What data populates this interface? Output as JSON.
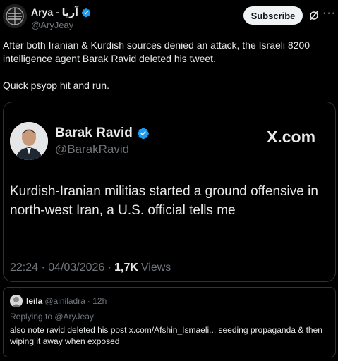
{
  "author": {
    "display_name": "Arya - آریا",
    "handle": "@AryJeay"
  },
  "actions": {
    "subscribe_label": "Subscribe",
    "more_label": "···"
  },
  "tweet": {
    "line1": "After both Iranian & Kurdish sources denied an attack, the Israeli 8200 intelligence agent Barak Ravid deleted his tweet.",
    "line2": "Quick psyop hit and run."
  },
  "embedded": {
    "name": "Barak Ravid",
    "handle": "@BarakRavid",
    "brand": "X.com",
    "text": "Kurdish-Iranian militias started a ground offensive in north-west Iran, a U.S. official tells me",
    "time": "22:24 · 04/03/2026 ·",
    "views_count": "1,7K",
    "views_label": "Views"
  },
  "reply": {
    "name": "leila",
    "handle": "@ainiladra",
    "time": "· 12h",
    "replying_to": "Replying to @AryJeay",
    "text": "also note ravid deleted his post x.com/Afshin_Ismaeli... seeding propaganda & then wiping it away when exposed"
  },
  "colors": {
    "background": "#000000",
    "text": "#e7e9ea",
    "muted": "#71767b",
    "verified": "#1d9bf0",
    "border": "#2f3336"
  }
}
